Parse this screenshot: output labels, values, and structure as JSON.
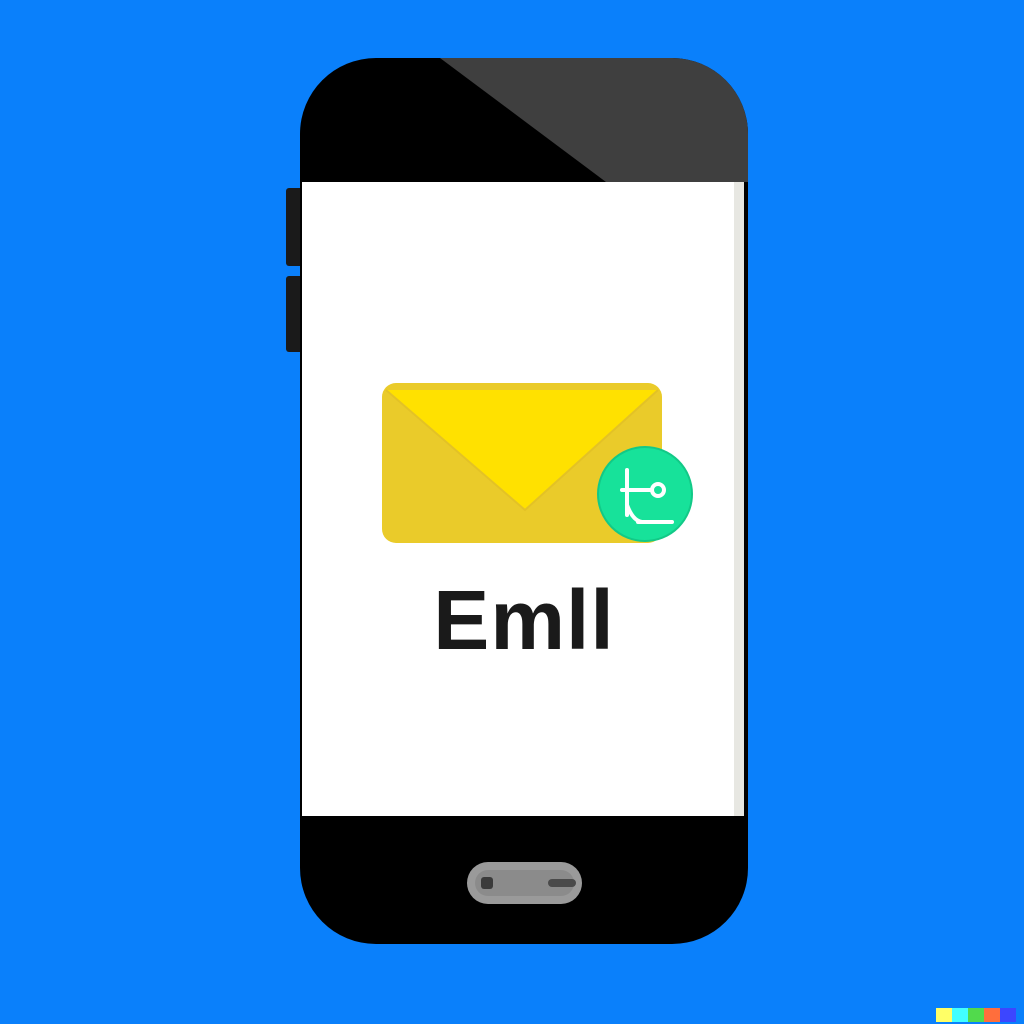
{
  "colors": {
    "background": "#0A80FB",
    "phone_body": "#000000",
    "phone_top_highlight": "#3F3F3F",
    "screen": "#FFFFFF",
    "envelope": "#EFD22A",
    "envelope_flap": "#FFE000",
    "badge": "#17E29A",
    "home_button": "#9A9A9A"
  },
  "icons": {
    "envelope": "mail-envelope-icon",
    "badge": "key-badge-icon",
    "home": "home-button"
  },
  "screen": {
    "label": "Emll"
  },
  "watermark": {
    "colors": [
      "#FFFF66",
      "#42FFFF",
      "#51DA4C",
      "#FF6E3C",
      "#3C46FF"
    ]
  }
}
